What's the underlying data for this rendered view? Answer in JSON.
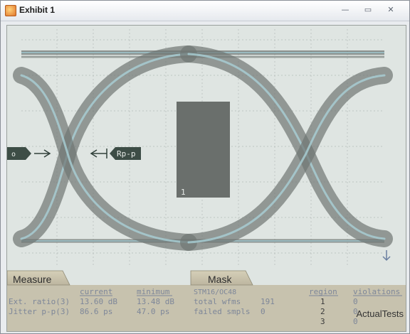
{
  "window": {
    "title": "Exhibit 1",
    "icons": [
      "app-icon",
      "minimize-icon",
      "maximize-icon",
      "close-icon"
    ],
    "glyphs": {
      "minimize": "—",
      "maximize": "▭",
      "close": "✕"
    }
  },
  "scope": {
    "marker_left_label": "o",
    "marker_label": "Rp-p",
    "mask_region_label": "1",
    "colors": {
      "background": "#dfe5e2",
      "eye": "#6f7673",
      "mask": "#6a6f6c"
    }
  },
  "measure_tab": {
    "label": "Measure",
    "col_current": "current",
    "col_minimum": "minimum",
    "rows": [
      {
        "label": "Ext. ratio(3)",
        "current": "13.60 dB",
        "minimum": "13.48 dB"
      },
      {
        "label": "Jitter p-p(3)",
        "current": "86.6 ps",
        "minimum": "47.0 ps"
      }
    ]
  },
  "mask_tab": {
    "label": "Mask",
    "standard": "STM16/OC48",
    "total_wfms_label": "total wfms",
    "total_wfms_value": "191",
    "failed_smpls_label": "failed smpls",
    "failed_smpls_value": "0",
    "col_region": "region",
    "col_violations": "violations",
    "regions": [
      {
        "region": "1",
        "violations": "0"
      },
      {
        "region": "2",
        "violations": "0"
      },
      {
        "region": "3",
        "violations": "0"
      }
    ]
  },
  "watermark": "ActualTests"
}
